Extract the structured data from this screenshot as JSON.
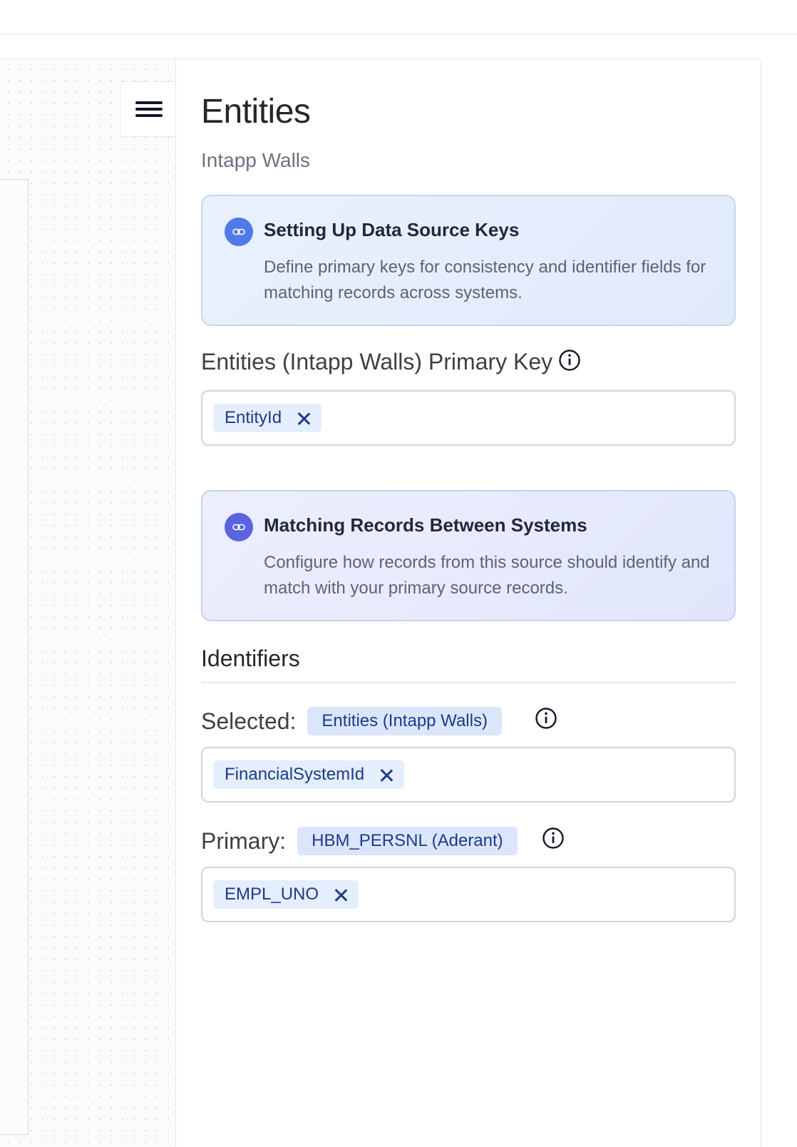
{
  "panel": {
    "title": "Entities",
    "subtitle": "Intapp Walls"
  },
  "callouts": {
    "keys": {
      "icon": "link-icon",
      "title": "Setting Up Data Source Keys",
      "body": "Define primary keys for consistency and identifier fields for matching records across systems."
    },
    "matching": {
      "icon": "link-icon",
      "title": "Matching Records Between Systems",
      "body": "Configure how records from this source should identify and match with your primary source records."
    }
  },
  "primary_key": {
    "label": "Entities (Intapp Walls) Primary Key",
    "tags": [
      "EntityId"
    ]
  },
  "identifiers": {
    "title": "Identifiers",
    "selected": {
      "label": "Selected:",
      "source": "Entities (Intapp Walls)",
      "tags": [
        "FinancialSystemId"
      ]
    },
    "primary": {
      "label": "Primary:",
      "source": "HBM_PERSNL (Aderant)",
      "tags": [
        "EMPL_UNO"
      ]
    }
  },
  "colors": {
    "accent_blue": "#4f7ae8",
    "accent_indigo": "#5b63e0",
    "chip_bg": "#e5eefc",
    "chip_text": "#1e3a8a"
  }
}
